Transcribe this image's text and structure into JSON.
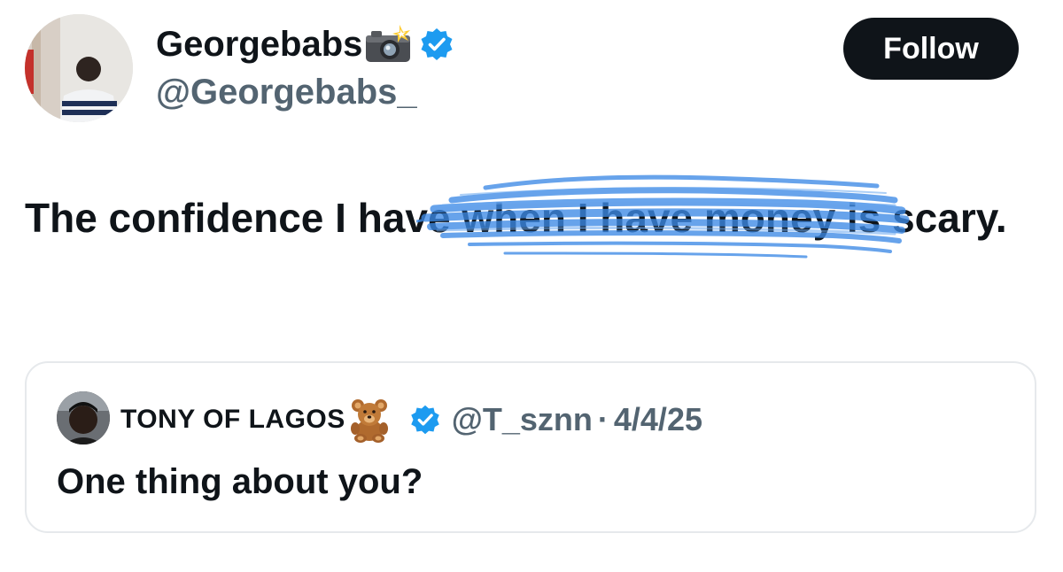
{
  "author": {
    "display_name": "Georgebabs",
    "handle": "@Georgebabs_",
    "verified": true,
    "name_emoji": "camera-with-flash"
  },
  "follow_label": "Follow",
  "tweet": {
    "text_before": "The confidence I have ",
    "text_scribbled": "when I have money",
    "text_after": " is scary."
  },
  "quoted": {
    "display_name": "TONY OF LAGOS",
    "name_emoji": "teddy-bear",
    "verified": true,
    "handle": "@T_sznn",
    "separator": "·",
    "date": "4/4/25",
    "text": "One thing about you?"
  },
  "colors": {
    "text": "#0f1419",
    "secondary": "#536471",
    "verified": "#1d9bf0",
    "scribble": "#3d8ae6",
    "follow_bg": "#0f1419",
    "card_border": "#e6e9ec"
  }
}
